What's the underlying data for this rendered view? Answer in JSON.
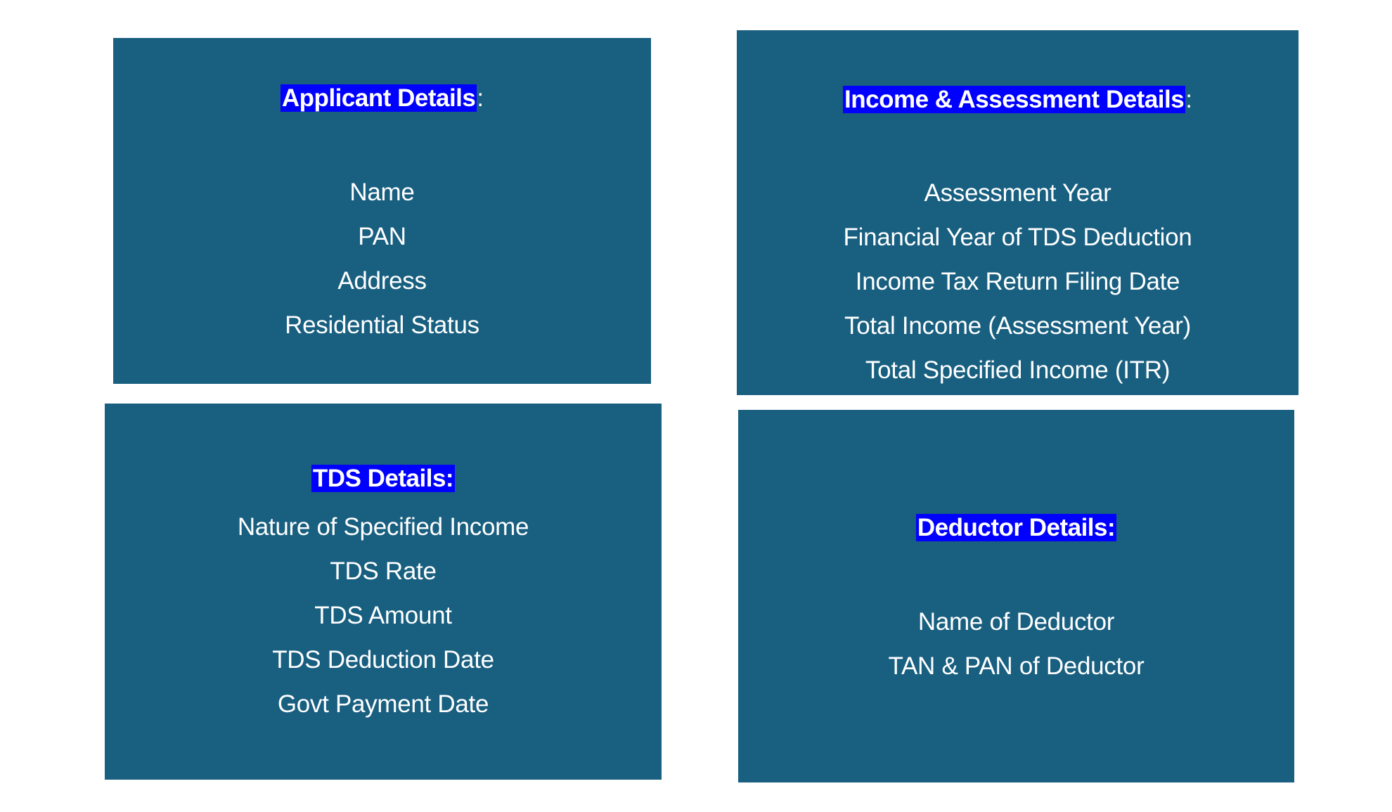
{
  "colors": {
    "card_background": "#185f80",
    "heading_highlight": "#0000ff",
    "text": "#ffffff",
    "page_background": "#ffffff"
  },
  "cards": {
    "applicant": {
      "heading": "Applicant Details",
      "heading_suffix": ":",
      "items": [
        "Name",
        "PAN",
        "Address",
        "Residential Status"
      ]
    },
    "income": {
      "heading": "Income & Assessment Details",
      "heading_suffix": ":",
      "items": [
        "Assessment Year",
        "Financial Year of TDS Deduction",
        "Income Tax Return Filing Date",
        "Total Income (Assessment Year)",
        "Total Specified Income (ITR)"
      ]
    },
    "tds": {
      "heading": "TDS Details:",
      "items": [
        "Nature of Specified Income",
        "TDS Rate",
        "TDS Amount",
        "TDS Deduction Date",
        "Govt Payment Date"
      ]
    },
    "deductor": {
      "heading": "Deductor Details:",
      "items": [
        "Name of Deductor",
        "TAN & PAN of Deductor"
      ]
    }
  }
}
